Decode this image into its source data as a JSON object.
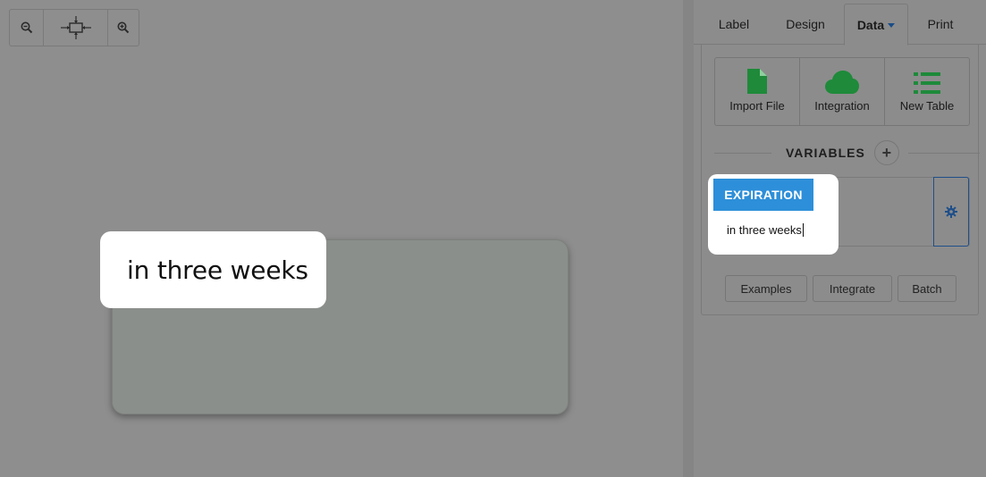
{
  "canvas": {
    "zoom_out_icon": "zoom-out-icon",
    "fit_icon": "fit-to-screen-icon",
    "zoom_in_icon": "zoom-in-icon",
    "label_preview_text": "in three weeks"
  },
  "tabs": [
    {
      "label": "Label"
    },
    {
      "label": "Design"
    },
    {
      "label": "Data",
      "active": true
    },
    {
      "label": "Print"
    }
  ],
  "sources": [
    {
      "label": "Import File",
      "icon": "file-icon"
    },
    {
      "label": "Integration",
      "icon": "cloud-icon"
    },
    {
      "label": "New Table",
      "icon": "list-icon"
    }
  ],
  "variables": {
    "heading": "VARIABLES",
    "add_label": "+",
    "items": [
      {
        "name": "EXPIRATION",
        "value": "in three weeks"
      }
    ]
  },
  "actions": {
    "examples": "Examples",
    "integrate": "Integrate",
    "batch": "Batch"
  },
  "colors": {
    "accent": "#2d8fd9",
    "source_icons": "#1e8a3a",
    "link": "#1f4f8a"
  }
}
